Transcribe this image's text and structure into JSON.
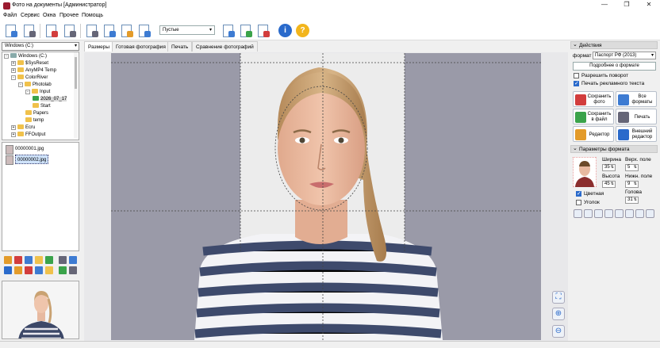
{
  "window": {
    "title": "Фото на документы  [Администратор]",
    "min": "—",
    "max": "❐",
    "close": "✕"
  },
  "menu": [
    "Файл",
    "Сервис",
    "Окна",
    "Прочее",
    "Помощь"
  ],
  "toolbar": {
    "filter_value": "Пустые",
    "info": "i",
    "help": "?"
  },
  "explorer": {
    "drive": "Windows (C:)",
    "tree": [
      {
        "label": "Windows (C:)",
        "level": 0,
        "exp": "-"
      },
      {
        "label": "$SysReset",
        "level": 1,
        "exp": "+"
      },
      {
        "label": "AnyMP4 Temp",
        "level": 1,
        "exp": "+"
      },
      {
        "label": "ColorRiver",
        "level": 1,
        "exp": "-"
      },
      {
        "label": "Photolab",
        "level": 2,
        "exp": "-"
      },
      {
        "label": "Input",
        "level": 3,
        "exp": "-"
      },
      {
        "label": "2026_07_17",
        "level": 4,
        "exp": ""
      },
      {
        "label": "Start",
        "level": 4,
        "exp": ""
      },
      {
        "label": "Papers",
        "level": 3,
        "exp": ""
      },
      {
        "label": "temp",
        "level": 3,
        "exp": ""
      },
      {
        "label": "Ecru",
        "level": 1,
        "exp": "+"
      },
      {
        "label": "FFOutput",
        "level": 1,
        "exp": "+"
      }
    ],
    "files": [
      "00000001.jpg",
      "00000002.jpg"
    ]
  },
  "tabs": [
    "Размеры",
    "Готовая фотография",
    "Печать",
    "Сравнение фотографий"
  ],
  "actions": {
    "header": "Действия",
    "format_label": "формат",
    "format_value": "Паспорт РФ (2013)",
    "about_format": "Подробнее о формате",
    "allow_rotate": "Разрешить поворот",
    "print_ad": "Печать рекламного текста",
    "buttons": [
      {
        "l1": "Сохранить",
        "l2": "фото"
      },
      {
        "l1": "Все",
        "l2": "форматы"
      },
      {
        "l1": "Сохранить",
        "l2": "в файл"
      },
      {
        "l1": "Печать",
        "l2": ""
      },
      {
        "l1": "Редактор",
        "l2": ""
      },
      {
        "l1": "Внешний",
        "l2": "редактор"
      }
    ]
  },
  "params": {
    "header": "Параметры формата",
    "width_label": "Ширина",
    "width": "35",
    "top_label": "Верх. поле",
    "top": "5",
    "height_label": "Высота",
    "height": "45",
    "bottom_label": "Нижн. поле",
    "bottom": "9",
    "color_label": "Цветная",
    "corner_label": "Уголок",
    "head_label": "Голова",
    "head": "31"
  }
}
